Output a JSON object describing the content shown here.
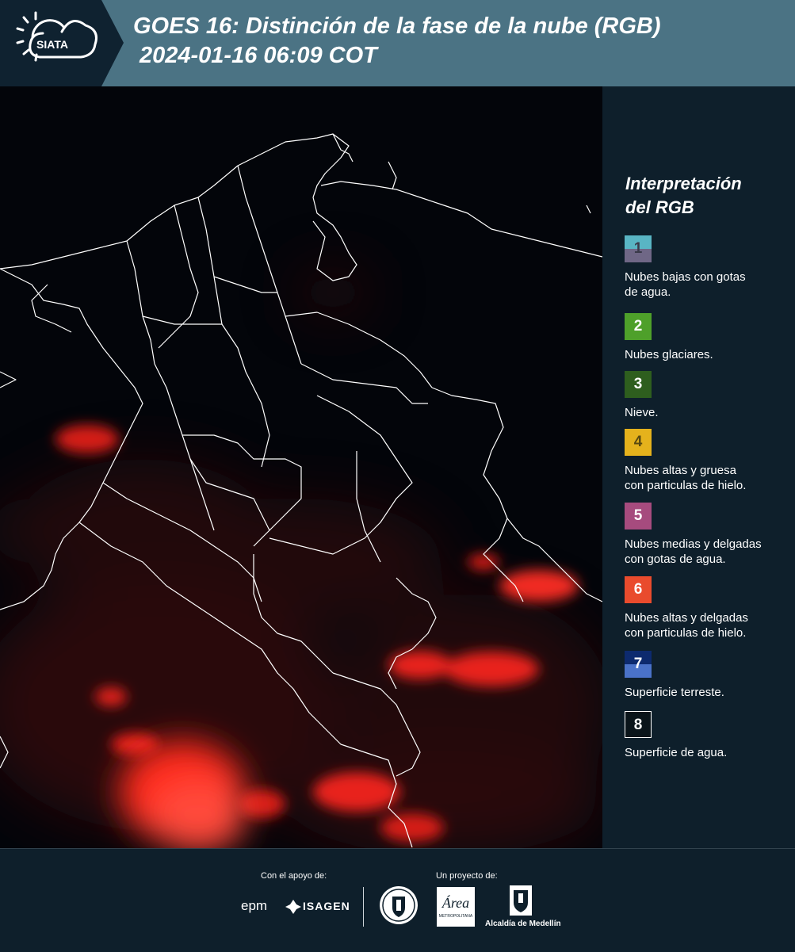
{
  "header": {
    "logo_text": "SIATA",
    "title_line1": "GOES 16: Distinción de la fase de la nube (RGB)",
    "title_line2": "2024-01-16 06:09 COT",
    "background": "#4b7384",
    "logo_background": "#0f2230"
  },
  "map": {
    "description_icon": "satellite-map",
    "background": "#03050a",
    "border_color": "#ffffff",
    "cloud_color": "#ff2a1f"
  },
  "legend": {
    "title_line1": "Interpretación",
    "title_line2": "del RGB",
    "items": [
      {
        "number": "1",
        "label_line1": "Nubes bajas con gotas",
        "label_line2": "de agua.",
        "color_top": "#59b5c4",
        "color_bottom": "#6f6786",
        "text_color": "#3a3a4a"
      },
      {
        "number": "2",
        "label_line1": "Nubes glaciares.",
        "label_line2": "",
        "color_top": "#4ea02a",
        "color_bottom": "#4ea02a",
        "text_color": "#ffffff"
      },
      {
        "number": "3",
        "label_line1": "Nieve.",
        "label_line2": "",
        "color_top": "#2e5e1e",
        "color_bottom": "#2e5e1e",
        "text_color": "#ffffff"
      },
      {
        "number": "4",
        "label_line1": "Nubes altas y gruesa",
        "label_line2": "con particulas de hielo.",
        "color_top": "#e5b21c",
        "color_bottom": "#e5b21c",
        "text_color": "#5a4a10"
      },
      {
        "number": "5",
        "label_line1": "Nubes medias y delgadas",
        "label_line2": "con gotas de agua.",
        "color_top": "#a64b7e",
        "color_bottom": "#a64b7e",
        "text_color": "#ffffff"
      },
      {
        "number": "6",
        "label_line1": "Nubes altas y delgadas",
        "label_line2": "con particulas de hielo.",
        "color_top": "#e94b2d",
        "color_bottom": "#e94b2d",
        "text_color": "#ffffff"
      },
      {
        "number": "7",
        "label_line1": "Superficie terreste.",
        "label_line2": "",
        "color_top": "#0d2a6e",
        "color_bottom": "#4a72c8",
        "text_color": "#ffffff"
      },
      {
        "number": "8",
        "label_line1": "Superficie de agua.",
        "label_line2": "",
        "color_top": "#0a141a",
        "color_bottom": "#0a141a",
        "text_color": "#ffffff"
      }
    ]
  },
  "footer": {
    "support_label": "Con el apoyo de:",
    "project_label": "Un proyecto de:",
    "sponsor1": "epm",
    "sponsor2": "ISAGEN",
    "partner_area": "Área",
    "partner_area_sub": "METROPOLITANA",
    "partner_alcaldia": "Alcaldía de Medellín"
  }
}
